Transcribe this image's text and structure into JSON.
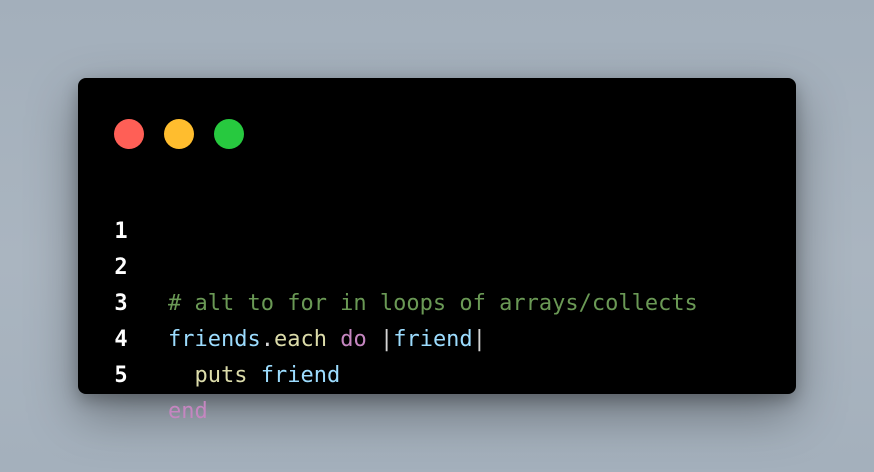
{
  "window": {
    "controls": [
      {
        "name": "close",
        "color": "#ff5f56"
      },
      {
        "name": "minimize",
        "color": "#ffbd2e"
      },
      {
        "name": "maximize",
        "color": "#27c93f"
      }
    ]
  },
  "code": {
    "lines": [
      {
        "number": "1",
        "tokens": []
      },
      {
        "number": "2",
        "tokens": [
          {
            "text": "# alt to for in loops of arrays/collects",
            "kind": "comment"
          }
        ]
      },
      {
        "number": "3",
        "tokens": [
          {
            "text": "friends",
            "kind": "variable"
          },
          {
            "text": ".",
            "kind": "punct"
          },
          {
            "text": "each",
            "kind": "method"
          },
          {
            "text": " ",
            "kind": "punct"
          },
          {
            "text": "do",
            "kind": "keyword"
          },
          {
            "text": " |",
            "kind": "punct"
          },
          {
            "text": "friend",
            "kind": "variable"
          },
          {
            "text": "|",
            "kind": "punct"
          }
        ]
      },
      {
        "number": "4",
        "tokens": [
          {
            "text": "  ",
            "kind": "punct"
          },
          {
            "text": "puts",
            "kind": "method"
          },
          {
            "text": " ",
            "kind": "punct"
          },
          {
            "text": "friend",
            "kind": "variable"
          }
        ]
      },
      {
        "number": "5",
        "tokens": [
          {
            "text": "end",
            "kind": "keyword"
          }
        ]
      }
    ]
  },
  "colors": {
    "comment": "#6a9955",
    "variable": "#9cdcfe",
    "method": "#dcdcaa",
    "keyword": "#c586c0",
    "punct": "#d4d4d4",
    "line_number": "#ffffff",
    "editor_background": "#000000"
  }
}
